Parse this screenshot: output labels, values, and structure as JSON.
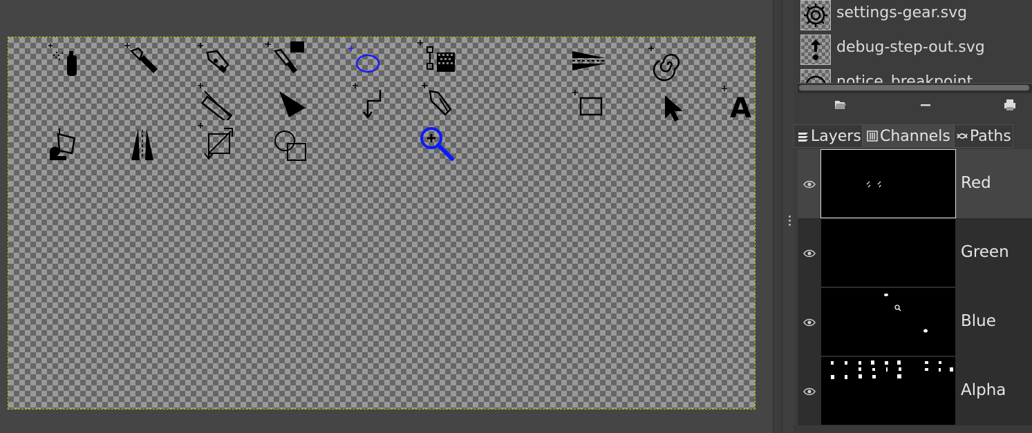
{
  "canvas": {
    "tool_icons": [
      {
        "name": "airbrush-icon"
      },
      {
        "name": "ink-smudge-icon"
      },
      {
        "name": "ink-pen-icon"
      },
      {
        "name": "clone-icon"
      },
      {
        "name": "ellipse-select-icon"
      },
      {
        "name": "fuzzy-select-icon"
      },
      {
        "name": "flip-icon"
      },
      {
        "name": "warp-spiral-icon"
      },
      {
        "name": "measure-icon"
      },
      {
        "name": "triangle-icon"
      },
      {
        "name": "path-icon"
      },
      {
        "name": "pencil-icon"
      },
      {
        "name": "rect-select-icon"
      },
      {
        "name": "pointer-icon"
      },
      {
        "name": "text-icon"
      },
      {
        "name": "bucket-fill-icon"
      },
      {
        "name": "perspective-icon"
      },
      {
        "name": "transform-icon"
      },
      {
        "name": "shape-select-icon"
      },
      {
        "name": "zoom-icon"
      }
    ],
    "text_tool_letter": "A"
  },
  "brushes": {
    "items": [
      {
        "label": "settings-gear.svg",
        "icon": "gear-icon"
      },
      {
        "label": "debug-step-out.svg",
        "icon": "step-out-icon"
      },
      {
        "label": "notice_breakpoint",
        "icon": "breakpoint-icon"
      }
    ]
  },
  "tabs": [
    {
      "label": "Layers",
      "icon": "layers-icon",
      "active": false
    },
    {
      "label": "Channels",
      "icon": "channels-icon",
      "active": true
    },
    {
      "label": "Paths",
      "icon": "paths-icon",
      "active": false
    }
  ],
  "channels": [
    {
      "label": "Red",
      "selected": true
    },
    {
      "label": "Green",
      "selected": false
    },
    {
      "label": "Blue",
      "selected": false
    },
    {
      "label": "Alpha",
      "selected": false
    }
  ],
  "colors": {
    "background": "#454545",
    "dock": "#3c3c3c",
    "selection_dash": "#c8c800",
    "zoom_blue": "#0a1aff"
  }
}
